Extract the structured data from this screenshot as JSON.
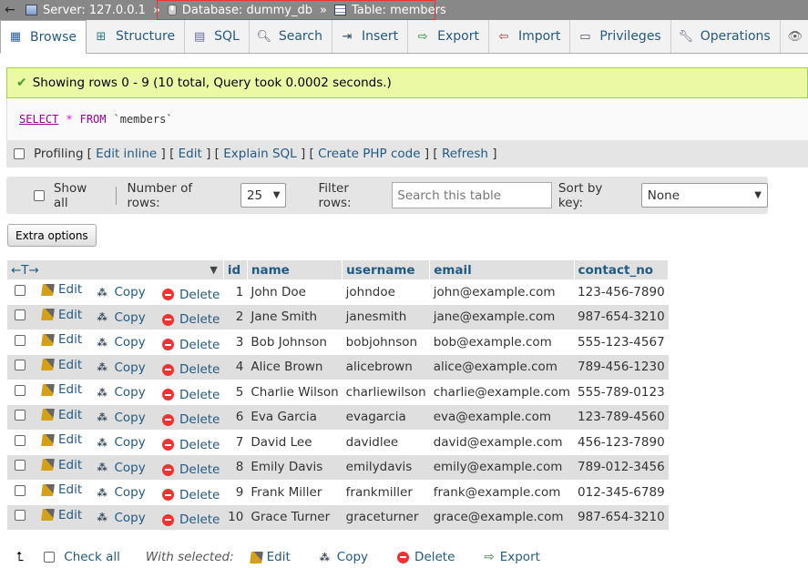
{
  "breadcrumb": {
    "server": "Server: 127.0.0.1",
    "database": "Database: dummy_db",
    "table": "Table: members"
  },
  "tabs": [
    {
      "label": "Browse",
      "icon": "browse-icon"
    },
    {
      "label": "Structure",
      "icon": "structure-icon"
    },
    {
      "label": "SQL",
      "icon": "sql-icon"
    },
    {
      "label": "Search",
      "icon": "search-icon"
    },
    {
      "label": "Insert",
      "icon": "insert-icon"
    },
    {
      "label": "Export",
      "icon": "export-icon"
    },
    {
      "label": "Import",
      "icon": "import-icon"
    },
    {
      "label": "Privileges",
      "icon": "privileges-icon"
    },
    {
      "label": "Operations",
      "icon": "operations-icon"
    }
  ],
  "message": "Showing rows 0 - 9 (10 total, Query took 0.0002 seconds.)",
  "sql": {
    "select": "SELECT",
    "star": "*",
    "from": "FROM",
    "table": "`members`"
  },
  "profiling": {
    "label": "Profiling",
    "links": [
      "Edit inline",
      "Edit",
      "Explain SQL",
      "Create PHP code",
      "Refresh"
    ]
  },
  "nav": {
    "show_all": "Show all",
    "num_rows_label": "Number of rows:",
    "num_rows_value": "25",
    "filter_label": "Filter rows:",
    "filter_placeholder": "Search this table",
    "sort_label": "Sort by key:",
    "sort_value": "None"
  },
  "extra_options": "Extra options",
  "columns": [
    "id",
    "name",
    "username",
    "email",
    "contact_no"
  ],
  "actions": {
    "edit": "Edit",
    "copy": "Copy",
    "delete": "Delete"
  },
  "rows": [
    {
      "id": "1",
      "name": "John Doe",
      "username": "johndoe",
      "email": "john@example.com",
      "contact_no": "123-456-7890"
    },
    {
      "id": "2",
      "name": "Jane Smith",
      "username": "janesmith",
      "email": "jane@example.com",
      "contact_no": "987-654-3210"
    },
    {
      "id": "3",
      "name": "Bob Johnson",
      "username": "bobjohnson",
      "email": "bob@example.com",
      "contact_no": "555-123-4567"
    },
    {
      "id": "4",
      "name": "Alice Brown",
      "username": "alicebrown",
      "email": "alice@example.com",
      "contact_no": "789-456-1230"
    },
    {
      "id": "5",
      "name": "Charlie Wilson",
      "username": "charliewilson",
      "email": "charlie@example.com",
      "contact_no": "555-789-0123"
    },
    {
      "id": "6",
      "name": "Eva Garcia",
      "username": "evagarcia",
      "email": "eva@example.com",
      "contact_no": "123-789-4560"
    },
    {
      "id": "7",
      "name": "David Lee",
      "username": "davidlee",
      "email": "david@example.com",
      "contact_no": "456-123-7890"
    },
    {
      "id": "8",
      "name": "Emily Davis",
      "username": "emilydavis",
      "email": "emily@example.com",
      "contact_no": "789-012-3456"
    },
    {
      "id": "9",
      "name": "Frank Miller",
      "username": "frankmiller",
      "email": "frank@example.com",
      "contact_no": "012-345-6789"
    },
    {
      "id": "10",
      "name": "Grace Turner",
      "username": "graceturner",
      "email": "grace@example.com",
      "contact_no": "987-654-3210"
    }
  ],
  "bottom": {
    "check_all": "Check all",
    "with_selected": "With selected:",
    "edit": "Edit",
    "copy": "Copy",
    "delete": "Delete",
    "export": "Export"
  }
}
